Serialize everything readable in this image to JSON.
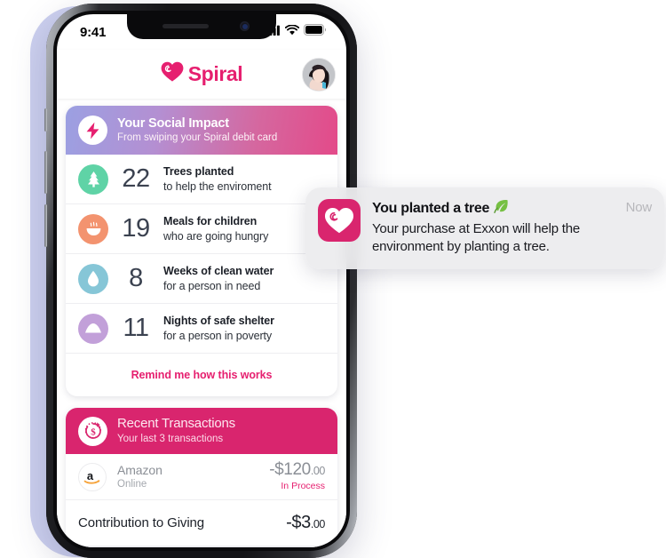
{
  "phone": {
    "status_bar": {
      "time": "9:41",
      "signal_icon": "cellular-signal-icon",
      "wifi_icon": "wifi-icon",
      "battery_icon": "battery-icon"
    },
    "app_header": {
      "logo_icon": "spiral-heart-logo-icon",
      "brand_name": "Spiral",
      "avatar_icon": "user-avatar"
    }
  },
  "impact_card": {
    "badge_icon": "lightning-bolt-icon",
    "title": "Your Social Impact",
    "subtitle": "From swiping your Spiral debit card",
    "rows": [
      {
        "icon": "tree-icon",
        "icon_color": "#5fd3a6",
        "value": "22",
        "label_main": "Trees planted",
        "label_sub": "to help the enviroment"
      },
      {
        "icon": "meal-bowl-icon",
        "icon_color": "#f3936f",
        "value": "19",
        "label_main": "Meals for children",
        "label_sub": "who are going hungry"
      },
      {
        "icon": "water-drop-icon",
        "icon_color": "#86c6d7",
        "value": "8",
        "label_main": "Weeks of clean water",
        "label_sub": "for a person in need"
      },
      {
        "icon": "shelter-icon",
        "icon_color": "#c2a0d9",
        "value": "11",
        "label_main": "Nights of safe shelter",
        "label_sub": "for a person in poverty"
      }
    ],
    "remind_link": "Remind me how this works"
  },
  "transactions_card": {
    "badge_icon": "cashback-dollar-icon",
    "title": "Recent Transactions",
    "subtitle": "Your last 3 transactions",
    "rows": [
      {
        "logo_icon": "amazon-logo-icon",
        "merchant": "Amazon",
        "sub": "Online",
        "amount": "-$120",
        "cents": ".00",
        "status": "In Process"
      },
      {
        "logo_icon": "",
        "merchant": "Contribution to Giving",
        "sub": "",
        "amount": "-$3",
        "cents": ".00",
        "status": ""
      }
    ]
  },
  "notification": {
    "app_icon": "spiral-app-icon",
    "title": "You planted a tree",
    "title_emoji": "leaf-emoji-icon",
    "message": "Your purchase at Exxon will help the environment by planting a tree.",
    "time": "Now"
  },
  "colors": {
    "brand_pink": "#e61f6f",
    "tx_header_pink": "#d9256e",
    "gradient_start": "#9ba0e2",
    "gradient_end": "#e34a89",
    "backdrop_lavender": "#ccd0ef"
  }
}
